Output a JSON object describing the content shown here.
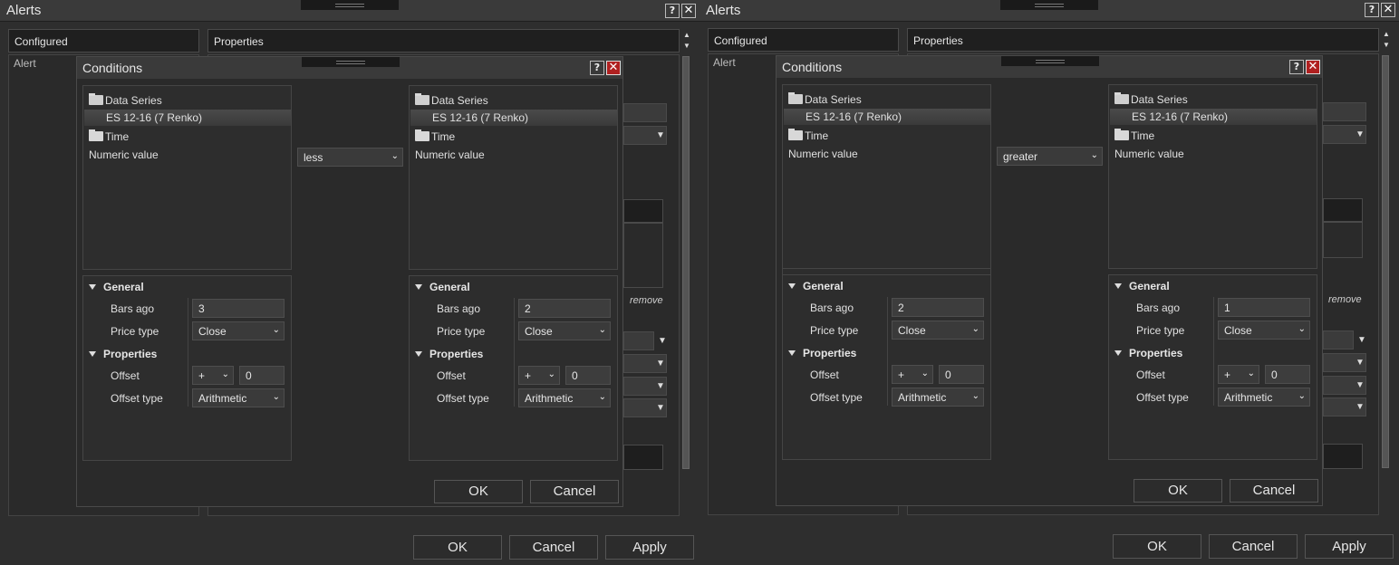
{
  "left": {
    "window_title": "Alerts",
    "header_configured": "Configured",
    "header_properties": "Properties",
    "col_alert": "Alert",
    "remove_label": "remove",
    "ok": "OK",
    "cancel": "Cancel",
    "apply": "Apply",
    "dialog": {
      "title": "Conditions",
      "help": "?",
      "close": "✕",
      "operator": "less",
      "left_tree": {
        "data_series": "Data Series",
        "series_value": "ES 12-16 (7 Renko)",
        "time": "Time",
        "numeric": "Numeric value"
      },
      "right_tree": {
        "data_series": "Data Series",
        "series_value": "ES 12-16 (7 Renko)",
        "time": "Time",
        "numeric": "Numeric value"
      },
      "left_props": {
        "general": "General",
        "bars_ago_label": "Bars ago",
        "bars_ago": "3",
        "price_type_label": "Price type",
        "price_type": "Close",
        "properties": "Properties",
        "offset_label": "Offset",
        "offset_sign": "+",
        "offset": "0",
        "offset_type_label": "Offset type",
        "offset_type": "Arithmetic"
      },
      "right_props": {
        "general": "General",
        "bars_ago_label": "Bars ago",
        "bars_ago": "2",
        "price_type_label": "Price type",
        "price_type": "Close",
        "properties": "Properties",
        "offset_label": "Offset",
        "offset_sign": "+",
        "offset": "0",
        "offset_type_label": "Offset type",
        "offset_type": "Arithmetic"
      },
      "ok": "OK",
      "cancel": "Cancel"
    }
  },
  "right": {
    "window_title": "Alerts",
    "header_configured": "Configured",
    "header_properties": "Properties",
    "col_alert": "Alert",
    "remove_label": "remove",
    "ok": "OK",
    "cancel": "Cancel",
    "apply": "Apply",
    "dialog": {
      "title": "Conditions",
      "help": "?",
      "close": "✕",
      "operator": "greater",
      "left_tree": {
        "data_series": "Data Series",
        "series_value": "ES 12-16 (7 Renko)",
        "time": "Time",
        "numeric": "Numeric value"
      },
      "right_tree": {
        "data_series": "Data Series",
        "series_value": "ES 12-16 (7 Renko)",
        "time": "Time",
        "numeric": "Numeric value"
      },
      "left_props": {
        "general": "General",
        "bars_ago_label": "Bars ago",
        "bars_ago": "2",
        "price_type_label": "Price type",
        "price_type": "Close",
        "properties": "Properties",
        "offset_label": "Offset",
        "offset_sign": "+",
        "offset": "0",
        "offset_type_label": "Offset type",
        "offset_type": "Arithmetic"
      },
      "right_props": {
        "general": "General",
        "bars_ago_label": "Bars ago",
        "bars_ago": "1",
        "price_type_label": "Price type",
        "price_type": "Close",
        "properties": "Properties",
        "offset_label": "Offset",
        "offset_sign": "+",
        "offset": "0",
        "offset_type_label": "Offset type",
        "offset_type": "Arithmetic"
      },
      "ok": "OK",
      "cancel": "Cancel"
    }
  },
  "icons": {
    "dropdown": "chevron-down-icon",
    "folder": "folder-icon",
    "expand": "triangle-down-icon"
  },
  "colors": {
    "background": "#2e2e2e",
    "close_button": "#b02020"
  }
}
